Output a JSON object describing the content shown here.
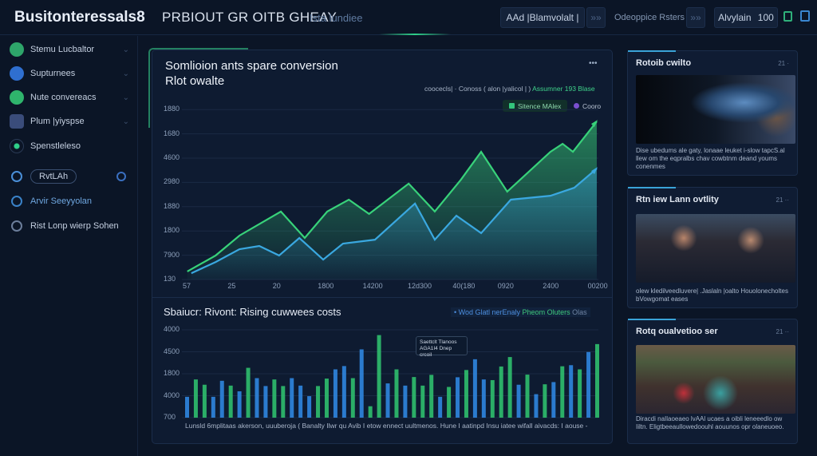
{
  "app": {
    "brand": "Busitonteressals8",
    "title": "PRBIOUT GR OITB GHEAY",
    "subtitle": "Ista lundiee"
  },
  "header": {
    "btn1": "AAd |Blamvolalt |",
    "btn1_arrow": "»»",
    "link": "Odeoppice Rsters",
    "btn2_arrow": "»»",
    "btn3": "Alvylain",
    "btn3_value": "100"
  },
  "sidebar": {
    "items": [
      {
        "label": "Stemu Lucbaltor",
        "icon": "leaf-icon",
        "color": "#2ea56a"
      },
      {
        "label": "Supturnees",
        "icon": "chat-icon",
        "color": "#2f6fd0"
      },
      {
        "label": "Nute convereacs",
        "icon": "cart-icon",
        "color": "#2fb46c"
      },
      {
        "label": "Plum |yiyspse",
        "icon": "card-icon",
        "color": "#3a4c7a"
      },
      {
        "label": "Spenstleleso",
        "icon": "radio-icon",
        "color": "#2fd08a"
      },
      {
        "label": "RvtLAh",
        "icon": "bell-icon",
        "color": "#4a8fd8"
      },
      {
        "label": "Arvir Seeyyolan",
        "icon": "link-icon",
        "color": "#3a82c8"
      },
      {
        "label": "Rist Lonp wierp Sohen",
        "icon": "person-icon",
        "color": "#6c7e9b"
      }
    ]
  },
  "line_panel": {
    "title": "Somlioion ants spare conversion",
    "subtitle": "Rlot owalte",
    "more": "•••",
    "legend_text": "coocecls| · Conoss ( alon |yalicol | )",
    "legend_accent": "Assumner 193 Blase",
    "chip1": "Sitence MAlex",
    "chip2": "Cooro"
  },
  "bar_panel": {
    "title": "Sbaiucr: Rivont: Rising cuwwees costs",
    "legend_a": "• Wod Glatl nerEnaly",
    "legend_b": "Pheom Oluters",
    "legend_c": "Olas",
    "tooltip_1": "Saettclt Tlanoos",
    "tooltip_2": "AGA1I4 Dnep crcoil",
    "footer": "Lunsld 6mplitaas akerson,  uuuberoja ( Banalty  Ilwr qu Avib I etow ennect uultmenos.  Hune I aatinpd Insu iatee wifall aivacds: I aouse -"
  },
  "cards": [
    {
      "title": "Rotoib cwilto",
      "meta": "21 ·",
      "desc": "Dise ubedums ale gaty, lonaae leuket i-slow tapcS.al llew om the eqpralbs chav cowbtnm deand youms conenmes"
    },
    {
      "title": "Rtn iew Lann ovtlity",
      "meta": "21 ··",
      "desc": "olew kledilveedluvere| .Jaslaln |oalto Houolonecholtes bVowgomat eases"
    },
    {
      "title": "Rotq oualvetioo ser",
      "meta": "21 ··",
      "desc": "Diracdi naIlaoeaeo lvAAl ucaes a oibli leneeedlo ow Iiltn. Eligtbeeaullowedoouhl aouunos opr olaneuoeo."
    }
  ],
  "chart_data": [
    {
      "type": "area",
      "title": "Somlioion ants spare conversion",
      "subtitle": "Rlot owalte",
      "y_tick_labels": [
        "130",
        "7900",
        "1800",
        "1880",
        "2980",
        "4600",
        "1680",
        "1880"
      ],
      "x_tick_labels": [
        "57",
        "25",
        "20",
        "1800",
        "14200",
        "12d300",
        "40(180",
        "0920",
        "2400",
        "00200"
      ],
      "grid": true,
      "series": [
        {
          "color": "#38d27a",
          "points": [
            [
              -0.04,
              0.33
            ],
            [
              0.59,
              0.99
            ],
            [
              1.12,
              1.81
            ],
            [
              2.04,
              2.8
            ],
            [
              2.57,
              1.71
            ],
            [
              3.07,
              2.8
            ],
            [
              3.55,
              3.29
            ],
            [
              4.0,
              2.7
            ],
            [
              4.88,
              3.95
            ],
            [
              5.46,
              2.8
            ],
            [
              6.04,
              4.11
            ],
            [
              6.49,
              5.26
            ],
            [
              7.07,
              3.62
            ],
            [
              8.03,
              5.26
            ],
            [
              8.3,
              5.59
            ],
            [
              8.53,
              5.26
            ],
            [
              9.06,
              6.51
            ]
          ]
        },
        {
          "color": "#3aa8e0",
          "points": [
            [
              0.05,
              0.26
            ],
            [
              0.59,
              0.72
            ],
            [
              1.12,
              1.25
            ],
            [
              1.56,
              1.38
            ],
            [
              2.0,
              0.99
            ],
            [
              2.45,
              1.71
            ],
            [
              2.98,
              0.82
            ],
            [
              3.42,
              1.48
            ],
            [
              4.13,
              1.64
            ],
            [
              5.02,
              3.13
            ],
            [
              5.46,
              1.64
            ],
            [
              5.94,
              2.63
            ],
            [
              6.49,
              1.91
            ],
            [
              7.15,
              3.29
            ],
            [
              8.03,
              3.45
            ],
            [
              8.56,
              3.78
            ],
            [
              9.06,
              4.57
            ]
          ]
        }
      ]
    },
    {
      "type": "bar",
      "title": "Sbaiucr: Rivont: Rising cuwwees costs",
      "y_tick_labels": [
        "700",
        "4000",
        "1800",
        "4500",
        "4000"
      ],
      "grid": true,
      "colors": {
        "b": "#2f86e0",
        "g": "#2fbf6e"
      },
      "bars": [
        [
          0.95,
          "b"
        ],
        [
          1.74,
          "g"
        ],
        [
          1.5,
          "g"
        ],
        [
          0.95,
          "b"
        ],
        [
          1.68,
          "b"
        ],
        [
          1.46,
          "g"
        ],
        [
          1.2,
          "b"
        ],
        [
          2.27,
          "g"
        ],
        [
          1.8,
          "b"
        ],
        [
          1.44,
          "b"
        ],
        [
          1.74,
          "g"
        ],
        [
          1.44,
          "g"
        ],
        [
          1.8,
          "b"
        ],
        [
          1.46,
          "b"
        ],
        [
          0.98,
          "b"
        ],
        [
          1.44,
          "g"
        ],
        [
          1.78,
          "g"
        ],
        [
          2.2,
          "b"
        ],
        [
          2.35,
          "b"
        ],
        [
          1.8,
          "g"
        ],
        [
          3.11,
          "b"
        ],
        [
          0.52,
          "g"
        ],
        [
          3.76,
          "g"
        ],
        [
          1.56,
          "b"
        ],
        [
          2.2,
          "g"
        ],
        [
          1.46,
          "b"
        ],
        [
          1.85,
          "g"
        ],
        [
          1.46,
          "g"
        ],
        [
          1.95,
          "g"
        ],
        [
          0.95,
          "b"
        ],
        [
          1.4,
          "g"
        ],
        [
          1.84,
          "b"
        ],
        [
          2.17,
          "g"
        ],
        [
          2.66,
          "b"
        ],
        [
          1.74,
          "b"
        ],
        [
          1.71,
          "g"
        ],
        [
          2.33,
          "g"
        ],
        [
          2.76,
          "g"
        ],
        [
          1.5,
          "b"
        ],
        [
          1.96,
          "g"
        ],
        [
          1.07,
          "b"
        ],
        [
          1.52,
          "g"
        ],
        [
          1.62,
          "b"
        ],
        [
          2.34,
          "g"
        ],
        [
          2.39,
          "b"
        ],
        [
          2.2,
          "g"
        ],
        [
          2.99,
          "b"
        ],
        [
          3.35,
          "g"
        ]
      ]
    }
  ]
}
